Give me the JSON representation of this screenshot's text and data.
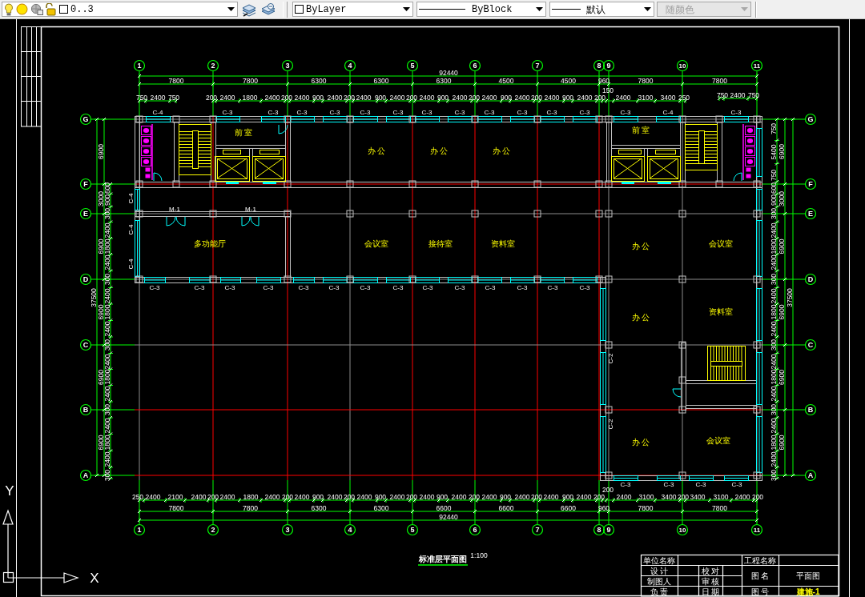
{
  "toolbar": {
    "layer": {
      "name": "0..3",
      "on": true,
      "frozen": false,
      "locked": false
    },
    "color_setting": "ByLayer",
    "linetype": "ByBlock",
    "lineweight": "默认",
    "plot_style": {
      "label": "随颜色",
      "disabled": true
    }
  },
  "drawing": {
    "top_axis_labels": [
      "1",
      "2",
      "3",
      "4",
      "5",
      "6",
      "7",
      "8",
      "9",
      "10",
      "11"
    ],
    "bottom_axis_labels": [
      "1",
      "2",
      "3",
      "4",
      "5",
      "6",
      "7",
      "8",
      "9",
      "10",
      "11"
    ],
    "left_axis_labels": [
      "G",
      "F",
      "E",
      "D",
      "C",
      "B",
      "A"
    ],
    "right_axis_labels": [
      "G",
      "F",
      "E",
      "D",
      "C",
      "B",
      "A"
    ],
    "top_dimensions": {
      "total": "92440",
      "bays": [
        "7800",
        "7800",
        "6300",
        "6300",
        "6300",
        "4500",
        "4500",
        "960",
        "7800",
        "7800"
      ],
      "segments": [
        "750",
        "2400",
        "750",
        "200",
        "2400",
        "1800",
        "2400",
        "200",
        "2400",
        "900",
        "2400",
        "200",
        "2400",
        "900",
        "2400",
        "200",
        "2400",
        "900",
        "2400",
        "200",
        "2400",
        "900",
        "2400",
        "200",
        "2400",
        "900",
        "2400",
        "200",
        "150",
        "2400",
        "3100",
        "3400",
        "250",
        "750",
        "2400",
        "750"
      ]
    },
    "bottom_dimensions": {
      "total": "92440",
      "bays": [
        "7800",
        "7800",
        "6300",
        "6300",
        "6600",
        "6600",
        "6600",
        "960",
        "7800",
        "7800"
      ],
      "segments": [
        "250",
        "2400",
        "2100",
        "2400",
        "200",
        "2400",
        "1800",
        "2400",
        "200",
        "2400",
        "900",
        "2400",
        "200",
        "2400",
        "900",
        "2400",
        "200",
        "2400",
        "900",
        "2400",
        "200",
        "2400",
        "900",
        "2400",
        "200",
        "2400",
        "900",
        "2400",
        "200",
        "200",
        "2400",
        "3100",
        "3400",
        "200",
        "3400",
        "3100",
        "2400",
        "200"
      ]
    },
    "left_dimensions": {
      "total": "37500",
      "bays": [
        "6900",
        "3000",
        "6900",
        "6900",
        "6900",
        "6900"
      ],
      "segments": [
        "600",
        "900",
        "300",
        "2400",
        "1800",
        "2400",
        "300",
        "2400",
        "1800",
        "2400",
        "300",
        "2400",
        "1800",
        "2400",
        "300",
        "2400",
        "1800",
        "2400",
        "300"
      ]
    },
    "right_dimensions": {
      "total": "37500",
      "bays": [
        "6900",
        "3000",
        "6900",
        "6900",
        "6900",
        "6900"
      ],
      "segments": [
        "750",
        "5400",
        "750",
        "600",
        "900",
        "300",
        "2400",
        "1800",
        "2400",
        "300",
        "2400",
        "1800",
        "2400",
        "300",
        "2400",
        "1800",
        "2400",
        "300",
        "2400",
        "1800",
        "2400",
        "300"
      ]
    },
    "opening_tags": [
      "C-4",
      "C-3",
      "C-3",
      "C-3",
      "C-3",
      "C-3",
      "C-3",
      "C-3",
      "C-3",
      "C-3",
      "C-3",
      "C-3",
      "C-3",
      "C-3",
      "C-4",
      "C-3",
      "C-3",
      "C-3",
      "C-3",
      "C-3",
      "C-3",
      "C-3",
      "C-3",
      "C-3",
      "C-3",
      "C-3",
      "C-3",
      "C-3",
      "C-3",
      "C-3",
      "C-3",
      "C-3",
      "C-3",
      "C-3",
      "M-1",
      "M-1",
      "C-4",
      "C-4",
      "C-4",
      "C-2",
      "C-2"
    ],
    "room_names": [
      "前 室",
      "办 公",
      "办 公",
      "办 公",
      "多功能厅",
      "会议室",
      "接待室",
      "资料室",
      "前 室",
      "办 公",
      "会议室",
      "办 公",
      "资料室",
      "办 公",
      "会议室"
    ],
    "title": "标准层平面图",
    "scale": "1:100"
  },
  "title_block": {
    "labels": [
      "单位名称",
      "工程名称",
      "设 计",
      "校 对",
      "制图人",
      "审 核",
      "负 责",
      "日 期"
    ],
    "name_label": "图 名",
    "drawing_name": "平面图",
    "number_label": "图 号",
    "drawing_number": "建施-1"
  },
  "ucs_icon": {
    "x_label": "X",
    "y_label": "Y"
  }
}
